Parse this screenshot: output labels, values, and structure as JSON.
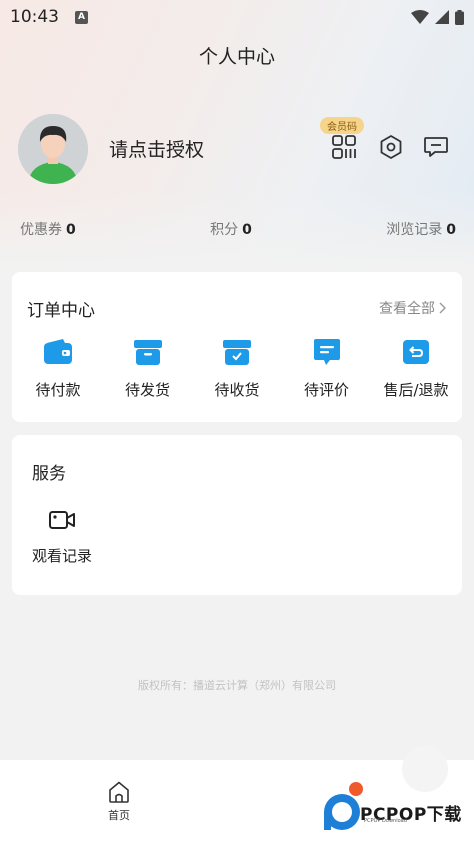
{
  "status_bar": {
    "time": "10:43",
    "notification_icon": "a-square-icon",
    "icons": [
      "wifi-icon",
      "signal-icon",
      "battery-icon"
    ]
  },
  "header": {
    "title": "个人中心"
  },
  "profile": {
    "avatar_icon": "user-avatar",
    "login_prompt": "请点击授权",
    "vip_badge": "会员码",
    "icons": [
      "member-code-icon",
      "settings-icon",
      "message-icon"
    ]
  },
  "stats": [
    {
      "label": "优惠券",
      "value": "0"
    },
    {
      "label": "积分",
      "value": "0"
    },
    {
      "label": "浏览记录",
      "value": "0"
    }
  ],
  "orders": {
    "title": "订单中心",
    "view_all": "查看全部",
    "items": [
      {
        "label": "待付款",
        "icon": "wallet-icon"
      },
      {
        "label": "待发货",
        "icon": "box-icon"
      },
      {
        "label": "待收货",
        "icon": "box-check-icon"
      },
      {
        "label": "待评价",
        "icon": "comment-icon"
      },
      {
        "label": "售后/退款",
        "icon": "refund-icon"
      }
    ]
  },
  "services": {
    "title": "服务",
    "items": [
      {
        "label": "观看记录",
        "icon": "video-camera-icon"
      }
    ]
  },
  "footer": {
    "copyright": "版权所有：播道云计算（郑州）有限公司"
  },
  "tabbar": {
    "items": [
      {
        "label": "首页",
        "icon": "home-icon"
      }
    ]
  },
  "watermark": {
    "text": "PCPOP下载",
    "sub": "PCPOP Download"
  },
  "colors": {
    "accent": "#1e9be8",
    "vip_badge_bg": "#f6d48a",
    "avatar_shirt": "#3fb34f"
  }
}
